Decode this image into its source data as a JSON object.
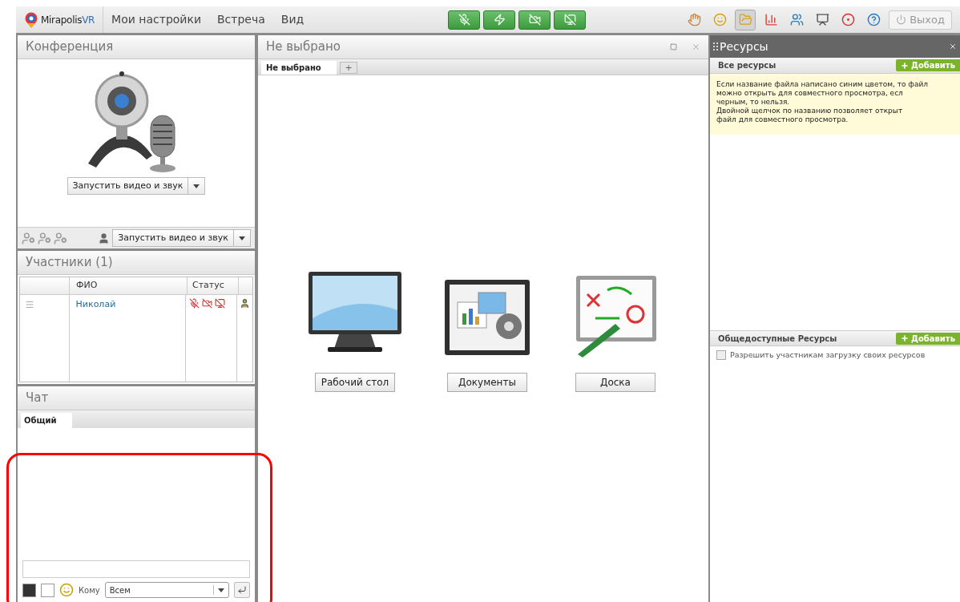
{
  "topbar": {
    "logo": "Mirapolis",
    "logo_suffix": "VR",
    "menu": [
      "Мои настройки",
      "Встреча",
      "Вид"
    ],
    "media_buttons": [
      {
        "kind": "microphone"
      },
      {
        "kind": "flash"
      },
      {
        "kind": "camera"
      },
      {
        "kind": "screen"
      }
    ],
    "tools": [
      {
        "kind": "hand",
        "selected": false
      },
      {
        "kind": "smile",
        "selected": false
      },
      {
        "kind": "folder",
        "selected": true
      },
      {
        "kind": "chart",
        "selected": false
      },
      {
        "kind": "users",
        "selected": false
      },
      {
        "kind": "presenter",
        "selected": false
      },
      {
        "kind": "record",
        "selected": false
      },
      {
        "kind": "help",
        "selected": false
      }
    ],
    "exit": "Выход"
  },
  "conference": {
    "title": "Конференция",
    "start_button": "Запустить видео и звук",
    "toolbar_button": "Запустить видео и звук"
  },
  "participants": {
    "title": "Участники (1)",
    "columns": [
      "ФИО",
      "Статус"
    ],
    "rows": [
      {
        "name": "Николай"
      }
    ]
  },
  "chat": {
    "title": "Чат",
    "tabs": [
      {
        "label": "Общий",
        "selected": true
      }
    ],
    "to_label": "Кому",
    "recipient": "Всем"
  },
  "workspace": {
    "title": "Не выбрано",
    "tabs": [
      {
        "label": "Не выбрано",
        "selected": true
      }
    ],
    "add_tab": "+",
    "options": [
      {
        "kind": "desktop",
        "label": "Рабочий стол"
      },
      {
        "kind": "documents",
        "label": "Документы"
      },
      {
        "kind": "board",
        "label": "Доска"
      }
    ]
  },
  "resources": {
    "title": "Ресурсы",
    "all_section": {
      "title": "Все ресурсы",
      "add": "Добавить"
    },
    "note_lines": [
      "Если название файла написано синим цветом, то файл",
      "можно открыть для совместного просмотра, есл",
      "черным, то нельзя.",
      "Двойной щелчок по названию позволяет открыт",
      "файл для совместного просмотра."
    ],
    "public_section": {
      "title": "Общедоступные Ресурсы",
      "add": "Добавить"
    },
    "allow_upload": {
      "label": "Разрешить участникам загрузку своих ресурсов",
      "checked": false
    }
  }
}
